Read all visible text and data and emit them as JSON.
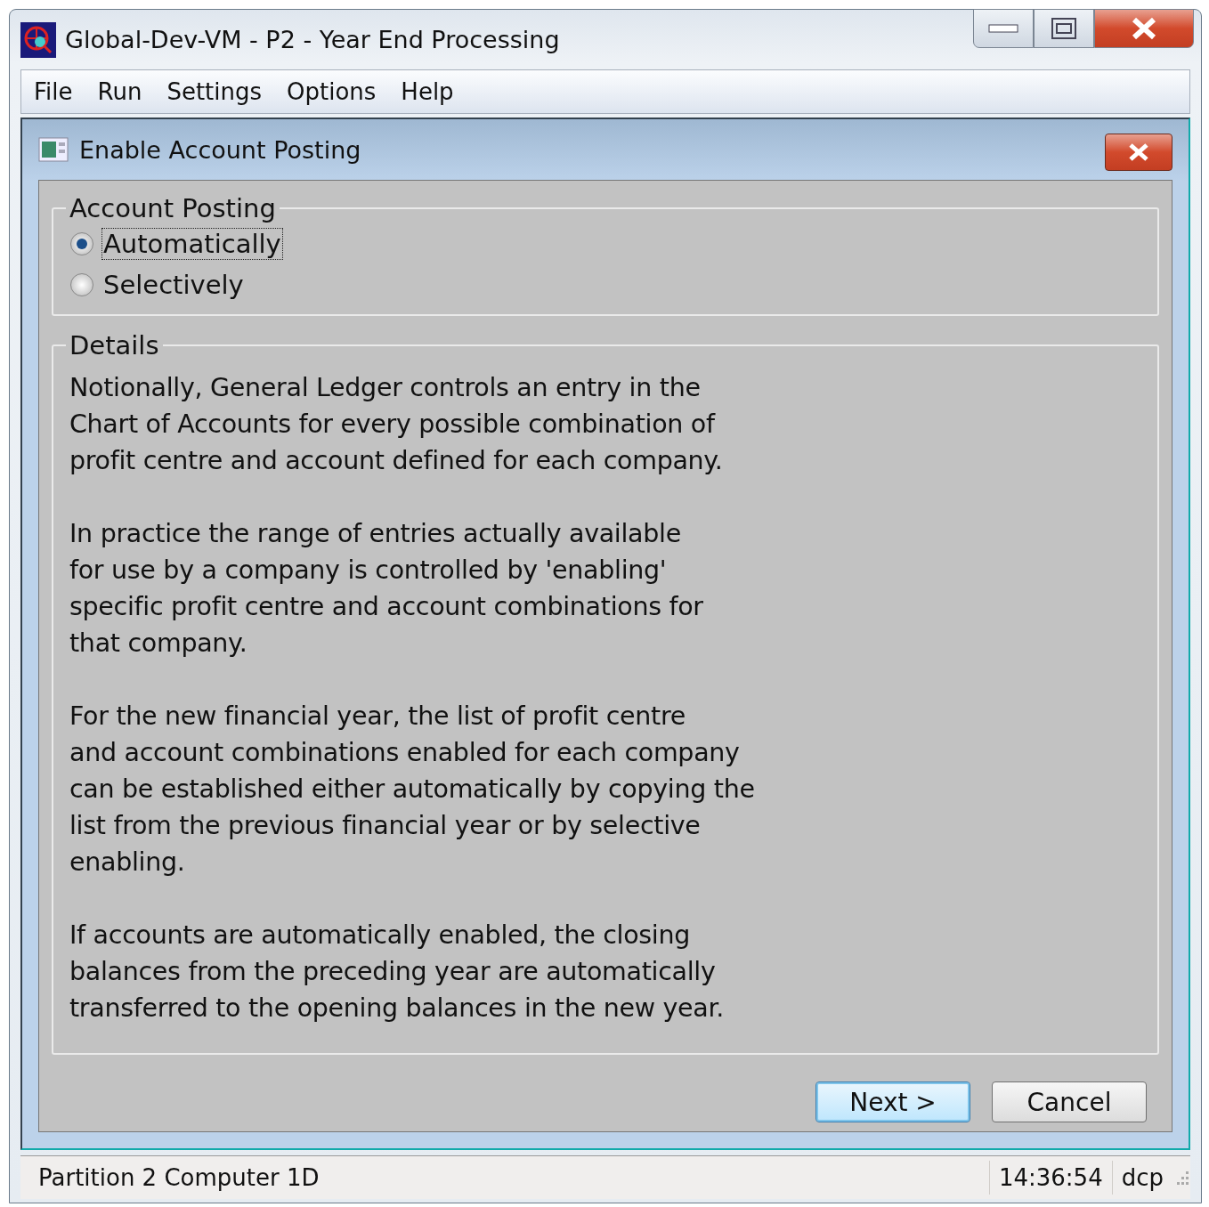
{
  "window": {
    "title": "Global-Dev-VM - P2 - Year End Processing"
  },
  "menu": [
    "File",
    "Run",
    "Settings",
    "Options",
    "Help"
  ],
  "dialog": {
    "title": "Enable Account Posting",
    "account_posting": {
      "label": "Account Posting",
      "options": [
        {
          "label": "Automatically",
          "selected": true,
          "focused": true
        },
        {
          "label": "Selectively",
          "selected": false,
          "focused": false
        }
      ]
    },
    "details": {
      "label": "Details",
      "paragraphs": [
        [
          "Notionally, General Ledger controls an entry in the",
          "Chart of Accounts for every possible combination of",
          "profit centre and account defined for each company."
        ],
        [
          "In practice the range of entries actually available",
          "for use by a company is controlled by 'enabling'",
          "specific profit centre and account combinations for",
          "that company."
        ],
        [
          "For the new financial year, the list of profit centre",
          "and account combinations enabled for each company",
          "can be established either automatically by copying the",
          "list from the previous financial year or by selective",
          "enabling."
        ],
        [
          "If accounts are automatically enabled, the closing",
          "balances from the preceding year are automatically",
          "transferred to the opening balances in the new year."
        ]
      ]
    },
    "buttons": [
      {
        "label": "Next >",
        "default": true
      },
      {
        "label": "Cancel",
        "default": false
      }
    ]
  },
  "status_bar": {
    "left": "Partition 2 Computer 1D",
    "time": "14:36:54",
    "user": "dcp"
  }
}
